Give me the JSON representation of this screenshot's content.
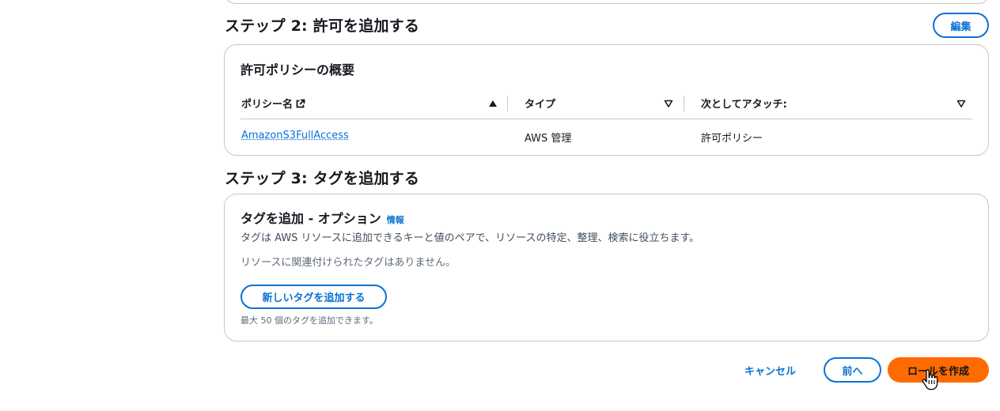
{
  "step2": {
    "title": "ステップ 2: 許可を追加する",
    "edit_label": "編集",
    "card_title": "許可ポリシーの概要",
    "table": {
      "columns": [
        "ポリシー名",
        "タイプ",
        "次としてアタッチ:"
      ],
      "rows": [
        {
          "policy_name": "AmazonS3FullAccess",
          "type": "AWS 管理",
          "attached_as": "許可ポリシー"
        }
      ]
    }
  },
  "step3": {
    "title": "ステップ 3: タグを追加する",
    "card_title": "タグを追加 - オプション",
    "info_label": "情報",
    "description": "タグは AWS リソースに追加できるキーと値のペアで、リソースの特定、整理、検索に役立ちます。",
    "empty_message": "リソースに関連付けられたタグはありません。",
    "add_tag_label": "新しいタグを追加する",
    "limit_note": "最大 50 個のタグを追加できます。"
  },
  "footer": {
    "cancel_label": "キャンセル",
    "previous_label": "前へ",
    "create_label": "ロールを作成"
  },
  "colors": {
    "link": "#0972d3",
    "primary": "#ff6b00",
    "border": "#c6c6cd"
  },
  "icons": {
    "external_link": "external-link-icon",
    "sort_asc": "sort-ascending-icon",
    "sort_none": "sort-icon",
    "cursor": "hand-pointer-cursor"
  }
}
